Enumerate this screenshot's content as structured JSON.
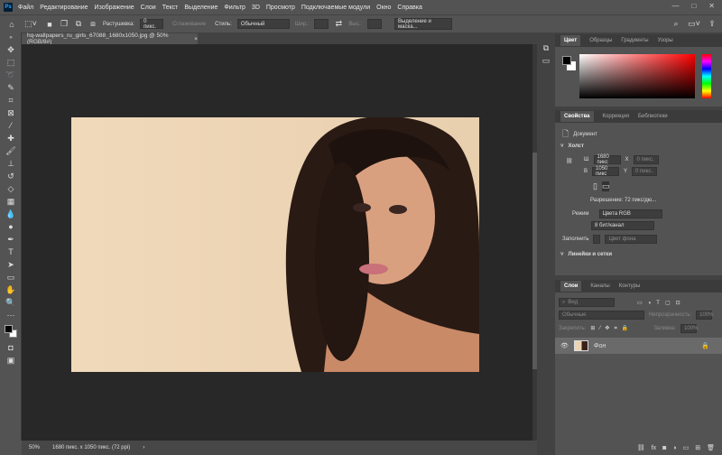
{
  "menu": {
    "logo": "Ps",
    "items": [
      "Файл",
      "Редактирование",
      "Изображение",
      "Слои",
      "Текст",
      "Выделение",
      "Фильтр",
      "3D",
      "Просмотр",
      "Подключаемые модули",
      "Окно",
      "Справка"
    ]
  },
  "window": {
    "minimize": "—",
    "maximize": "□",
    "close": "✕"
  },
  "options": {
    "feather_label": "Растушевка:",
    "feather_value": "0 пикс.",
    "antialias": "Сглаживание",
    "style_label": "Стиль:",
    "style_value": "Обычный",
    "width_label": "Шир.:",
    "height_label": "Выс.:",
    "select_mask": "Выделение и маска..."
  },
  "document": {
    "tab_title": "hq-wallpapers_ru_girls_67088_1680x1050.jpg @ 50% (RGB/8#)",
    "close": "×"
  },
  "status": {
    "zoom": "50%",
    "info": "1680 пикс. x 1050 пикс. (72 ppi)",
    "arrow": "›"
  },
  "color_panel": {
    "tabs": [
      "Цвет",
      "Образцы",
      "Градиенты",
      "Узоры"
    ],
    "foreground": "#000000",
    "background": "#ffffff",
    "hue_color": "#ff0000"
  },
  "properties_panel": {
    "tabs": [
      "Свойства",
      "Коррекция",
      "Библиотеки"
    ],
    "doc_label": "Документ",
    "canvas_section": "Холст",
    "w_label": "Ш",
    "w_value": "1680 пикс",
    "h_label": "В",
    "h_value": "1050 пикс",
    "x_label": "X",
    "x_value": "0 пикс.",
    "y_label": "Y",
    "y_value": "0 пикс.",
    "resolution": "Разрешение: 72 пикс/дю...",
    "mode_label": "Режим",
    "mode_value": "Цвета RGB",
    "depth_value": "8 бит/канал",
    "fill_label": "Заполнить",
    "fill_value": "Цвет фона",
    "rulers_section": "Линейки и сетки"
  },
  "layers_panel": {
    "tabs": [
      "Слои",
      "Каналы",
      "Контуры"
    ],
    "search_placeholder": "Вид",
    "blend_mode": "Обычные",
    "opacity_label": "Непрозрачность:",
    "opacity_value": "100%",
    "lock_label": "Закрепить:",
    "fill_label": "Заливка:",
    "fill_value": "100%",
    "layers": [
      {
        "name": "Фон",
        "visible": true,
        "locked": true
      }
    ]
  }
}
